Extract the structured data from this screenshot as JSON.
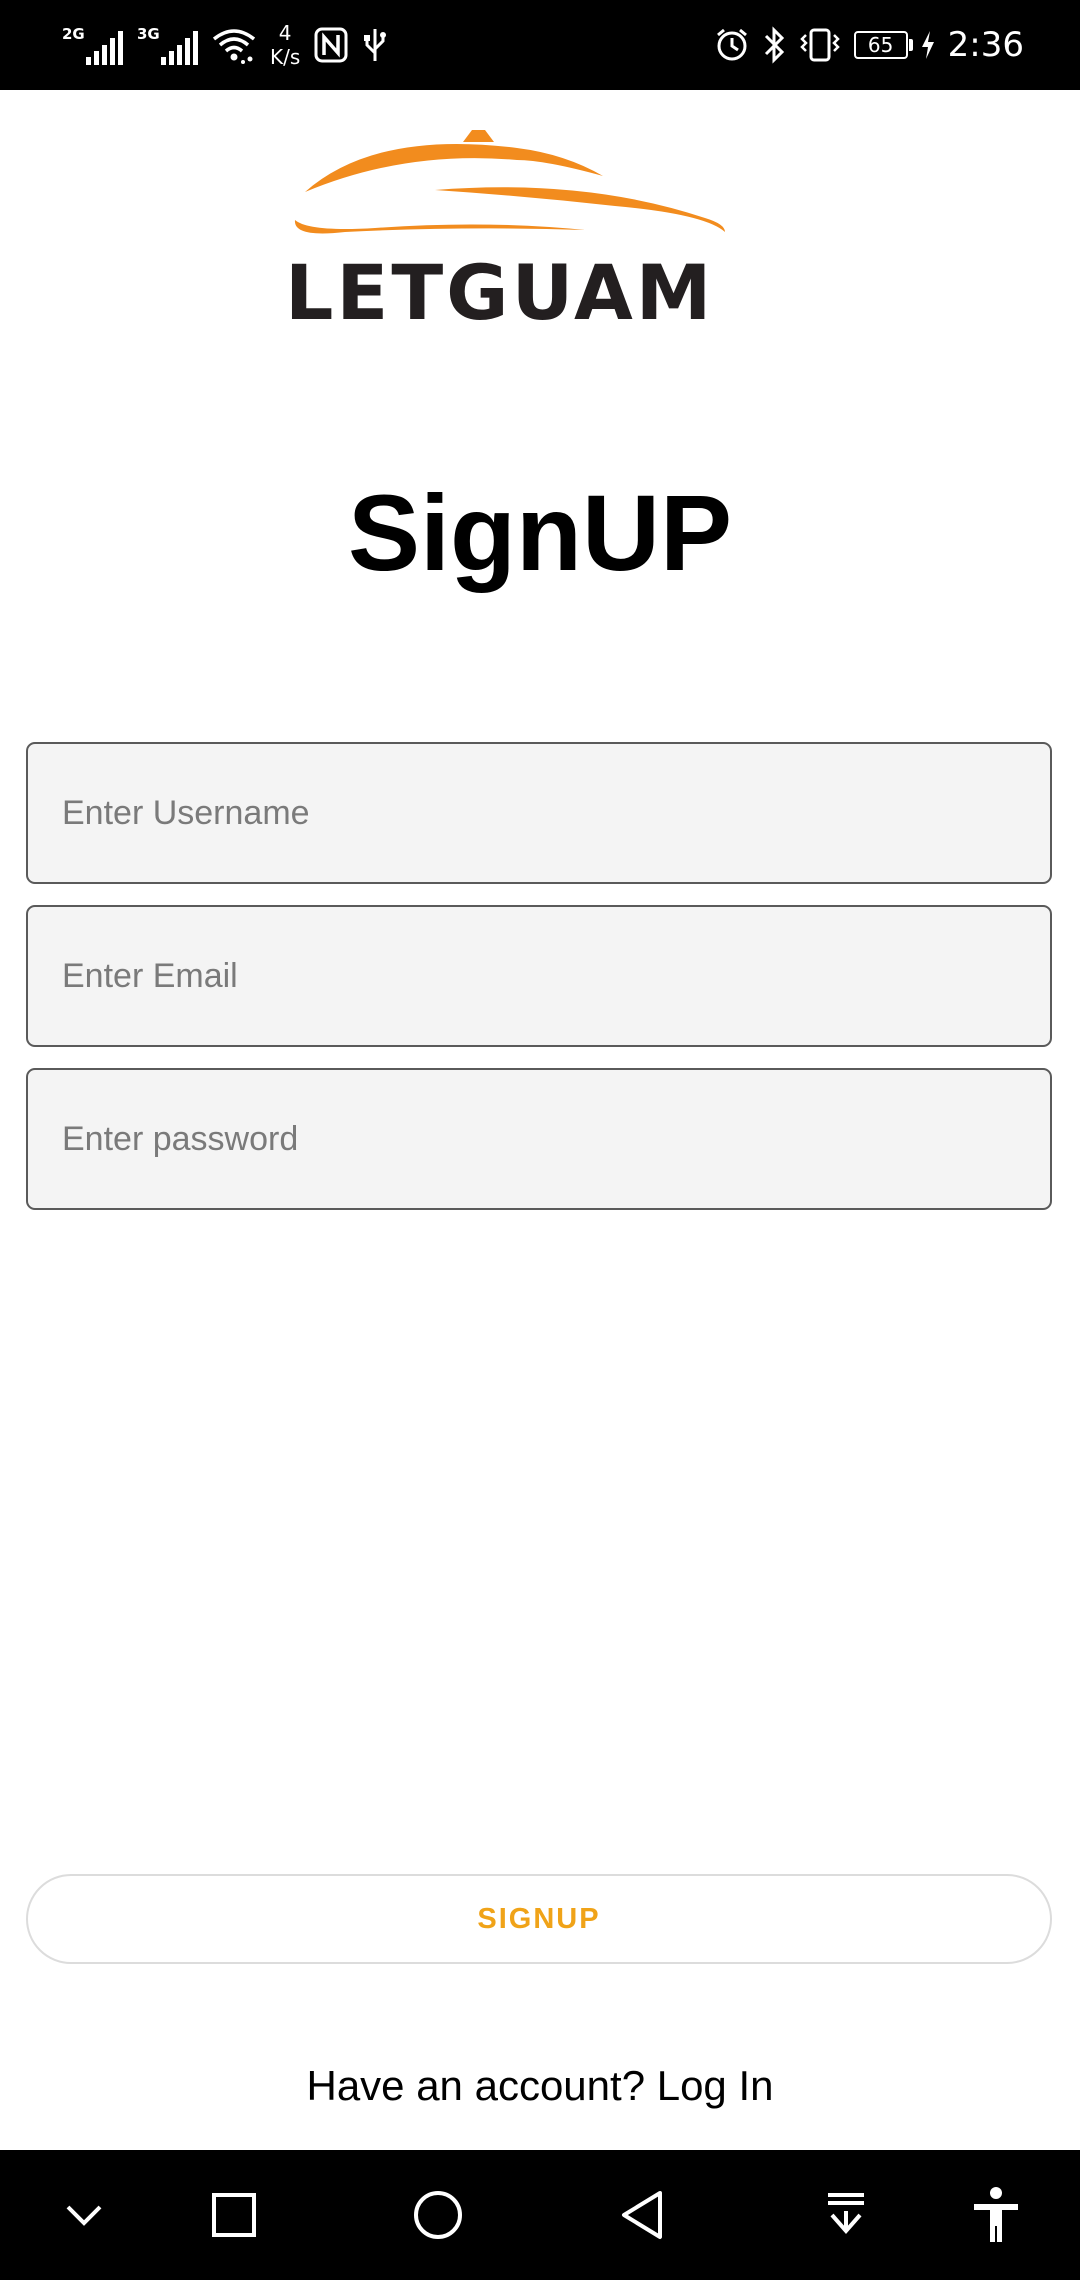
{
  "status_bar": {
    "sim1_gen": "2G",
    "sim2_gen": "3G",
    "speed_value": "4",
    "speed_unit": "K/s",
    "battery": "65",
    "time": "2:36"
  },
  "logo": {
    "text": "LETGUAM",
    "accent_color": "#f28c1e"
  },
  "page": {
    "title": "SignUP"
  },
  "form": {
    "username_placeholder": "Enter Username",
    "email_placeholder": "Enter Email",
    "password_placeholder": "Enter password"
  },
  "actions": {
    "signup_label": "SIGNUP",
    "login_prompt": "Have an account? Log In",
    "signup_color": "#f0a318"
  },
  "nav_bar": {
    "icons": [
      "chevron-down-icon",
      "square-icon",
      "circle-home-icon",
      "triangle-back-icon",
      "download-tray-icon",
      "accessibility-icon"
    ]
  }
}
